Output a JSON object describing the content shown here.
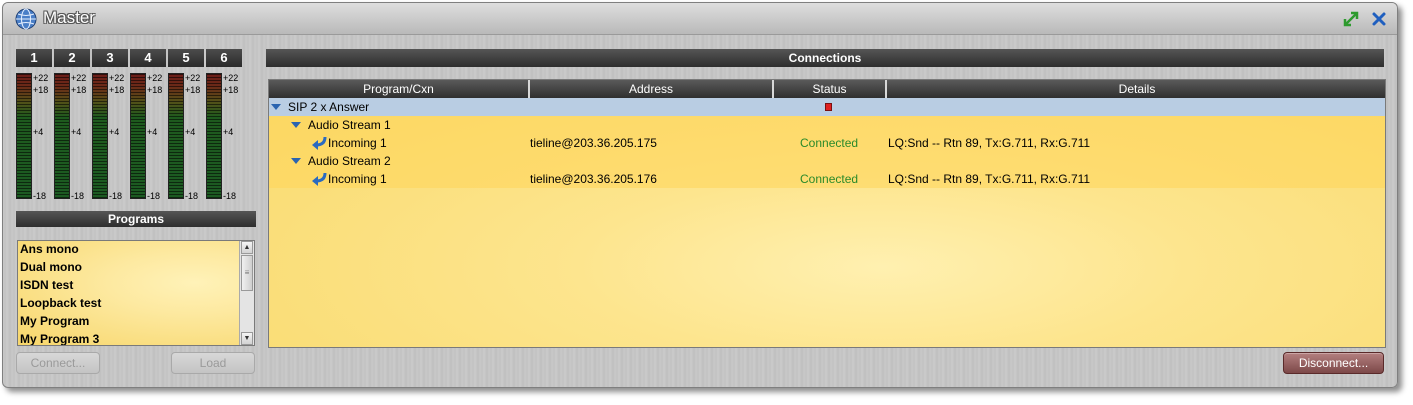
{
  "window": {
    "title": "Master",
    "icons": [
      "globe-icon",
      "expand-icon",
      "close-icon"
    ]
  },
  "meters": {
    "channels": [
      "1",
      "2",
      "3",
      "4",
      "5",
      "6"
    ],
    "scale_labels": [
      "+22",
      "+18",
      "+4",
      "-18"
    ]
  },
  "programs": {
    "header": "Programs",
    "items": [
      "Ans mono",
      "Dual mono",
      "ISDN test",
      "Loopback test",
      "My Program",
      "My Program 3"
    ],
    "connect_label": "Connect...",
    "load_label": "Load"
  },
  "connections": {
    "header": "Connections",
    "columns": [
      "Program/Cxn",
      "Address",
      "Status",
      "Details"
    ],
    "rows": [
      {
        "level": 0,
        "name": "SIP 2 x Answer",
        "address": "",
        "status": "",
        "details": ""
      },
      {
        "level": 1,
        "name": "Audio Stream 1",
        "address": "",
        "status": "",
        "details": ""
      },
      {
        "level": 2,
        "name": "Incoming 1",
        "address": "tieline@203.36.205.175",
        "status": "Connected",
        "details": "LQ:Snd -- Rtn 89, Tx:G.711, Rx:G.711"
      },
      {
        "level": 1,
        "name": "Audio Stream 2",
        "address": "",
        "status": "",
        "details": ""
      },
      {
        "level": 2,
        "name": "Incoming 1",
        "address": "tieline@203.36.205.176",
        "status": "Connected",
        "details": "LQ:Snd -- Rtn 89, Tx:G.711, Rx:G.711"
      }
    ],
    "disconnect_label": "Disconnect..."
  },
  "colors": {
    "connected": "#2a8a2a",
    "selected_row": "#b9cde3",
    "panel_yellow": "#f8d96a",
    "disconnect_button": "#7c4848"
  }
}
